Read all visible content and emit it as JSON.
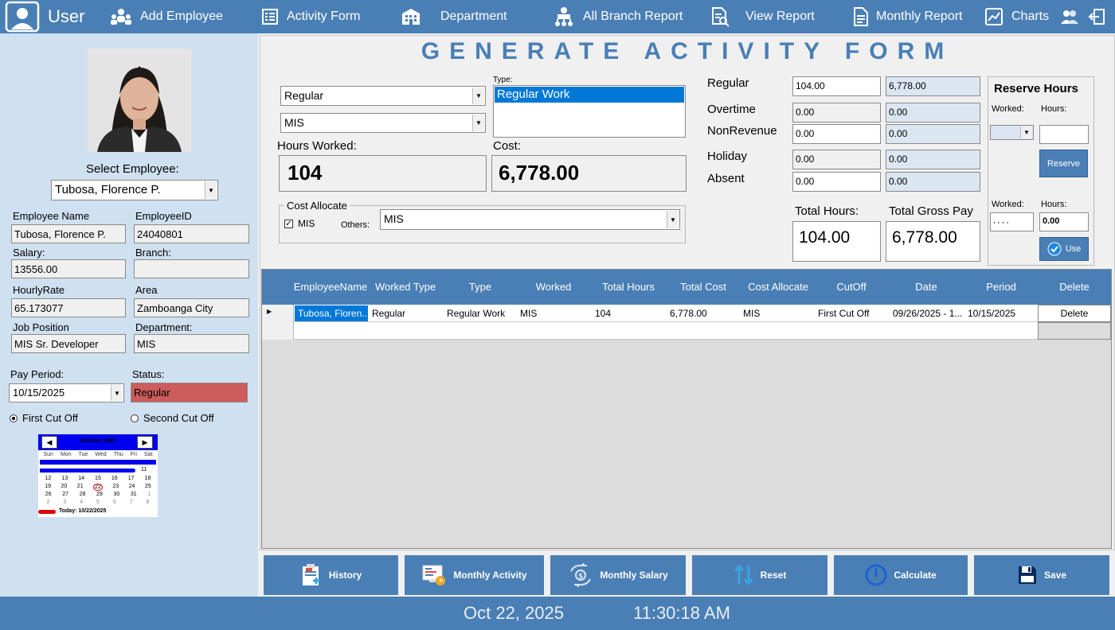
{
  "nav": {
    "user": "User",
    "add_employee": "Add Employee",
    "activity_form": "Activity Form",
    "department": "Department",
    "all_branch_report": "All Branch Report",
    "view_report": "View Report",
    "monthly_report": "Monthly Report",
    "charts": "Charts"
  },
  "title": "GENERATE ACTIVITY FORM",
  "employee": {
    "select_label": "Select Employee:",
    "selected": "Tubosa, Florence P.",
    "name_label": "Employee Name",
    "name": "Tubosa, Florence P.",
    "id_label": "EmployeeID",
    "id": "24040801",
    "salary_label": "Salary:",
    "salary": "13556.00",
    "branch_label": "Branch:",
    "branch": "",
    "hourly_label": "HourlyRate",
    "hourly": "65.173077",
    "area_label": "Area",
    "area": "Zamboanga City",
    "position_label": "Job Position",
    "position": "MIS Sr. Developer",
    "department_label": "Department:",
    "department": "MIS",
    "pay_period_label": "Pay Period:",
    "pay_period": "10/15/2025",
    "status_label": "Status:",
    "status": "Regular",
    "status_color": "#cd5c5c",
    "first_cutoff": "First Cut Off",
    "second_cutoff": "Second Cut Off"
  },
  "calendar": {
    "month": "October 2025",
    "days": [
      "Sun",
      "Mon",
      "Tue",
      "Wed",
      "Thu",
      "Fri",
      "Sat"
    ],
    "row3": [
      "",
      "",
      "",
      "",
      "",
      "",
      "11"
    ],
    "row4": [
      "12",
      "13",
      "14",
      "15",
      "16",
      "17",
      "18"
    ],
    "row5": [
      "19",
      "20",
      "21",
      "22",
      "23",
      "24",
      "25"
    ],
    "row6": [
      "26",
      "27",
      "28",
      "29",
      "30",
      "31",
      "1"
    ],
    "row7": [
      "2",
      "3",
      "4",
      "5",
      "6",
      "7",
      "8"
    ],
    "today": "Today: 10/22/2025"
  },
  "form": {
    "work_type": "Regular",
    "dept": "MIS",
    "type_label": "Type:",
    "type_selected": "Regular Work",
    "hours_label": "Hours Worked:",
    "hours": "104",
    "cost_label": "Cost:",
    "cost": "6,778.00",
    "cost_allocate_label": "Cost Allocate",
    "mis_check": "MIS",
    "others_label": "Others:",
    "others_value": "MIS"
  },
  "summary": {
    "regular_label": "Regular",
    "regular_hours": "104.00",
    "regular_pay": "6,778.00",
    "overtime_label": "Overtime",
    "overtime_hours": "0.00",
    "overtime_pay": "0.00",
    "nonrevenue_label": "NonRevenue",
    "nonrevenue_hours": "0.00",
    "nonrevenue_pay": "0.00",
    "holiday_label": "Holiday",
    "holiday_hours": "0.00",
    "holiday_pay": "0.00",
    "absent_label": "Absent",
    "absent_hours": "0.00",
    "absent_pay": "0.00",
    "total_hours_label": "Total Hours:",
    "total_hours": "104.00",
    "total_gross_label": "Total Gross Pay",
    "total_gross": "6,778.00"
  },
  "reserve": {
    "title": "Reserve Hours",
    "worked_label": "Worked:",
    "hours_label": "Hours:",
    "reserve_button": "Reserve",
    "worked_label2": "Worked:",
    "hours_label2": "Hours:",
    "worked_value": ", , , ,",
    "hours_value": "0.00",
    "use_button": "Use"
  },
  "grid": {
    "headers": [
      "EmployeeName",
      "Worked Type",
      "Type",
      "Worked",
      "Total Hours",
      "Total Cost",
      "Cost Allocate",
      "CutOff",
      "Date",
      "Period",
      "Delete"
    ],
    "row": [
      "Tubosa, Floren...",
      "Regular",
      "Regular Work",
      "MIS",
      "104",
      "6,778.00",
      "MIS",
      "First Cut Off",
      "09/26/2025 - 1...",
      "10/15/2025",
      "Delete"
    ]
  },
  "buttons": {
    "history": "History",
    "monthly_activity": "Monthly Activity",
    "monthly_salary": "Monthly Salary",
    "reset": "Reset",
    "calculate": "Calculate",
    "save": "Save"
  },
  "status": {
    "date": "Oct 22, 2025",
    "time": "11:30:18 AM"
  },
  "colors": {
    "accent": "#4a7fb5",
    "panel": "#cfe0f0"
  }
}
